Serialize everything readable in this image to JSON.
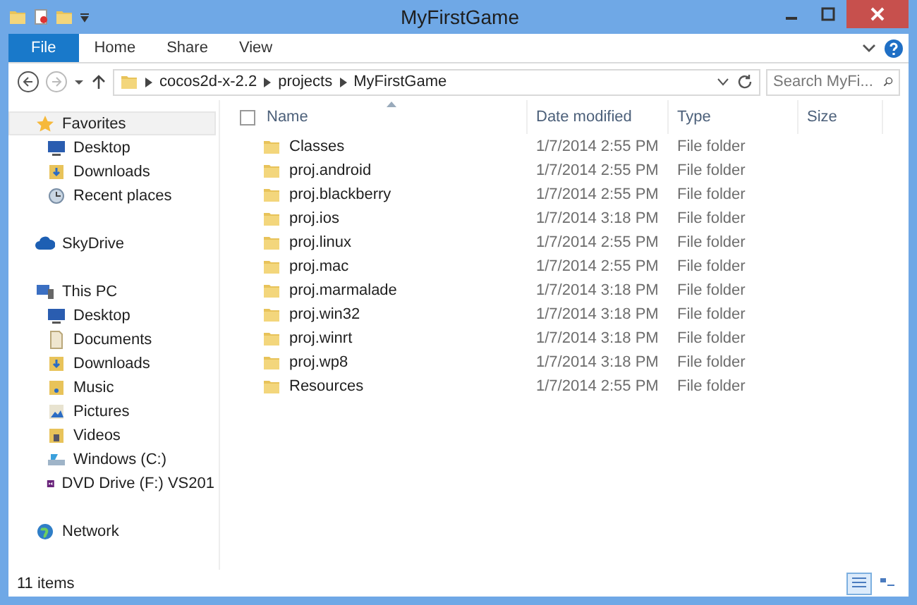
{
  "window": {
    "title": "MyFirstGame"
  },
  "ribbon": {
    "tabs": [
      {
        "label": "File",
        "kind": "file"
      },
      {
        "label": "Home",
        "kind": "tab"
      },
      {
        "label": "Share",
        "kind": "tab"
      },
      {
        "label": "View",
        "kind": "tab"
      }
    ]
  },
  "address": {
    "path": [
      "cocos2d-x-2.2",
      "projects",
      "MyFirstGame"
    ],
    "search_placeholder": "Search MyFi..."
  },
  "sidebar": {
    "groups": [
      {
        "label": "Favorites",
        "kind": "star",
        "selected": true,
        "children": [
          {
            "label": "Desktop",
            "kind": "desktop"
          },
          {
            "label": "Downloads",
            "kind": "download"
          },
          {
            "label": "Recent places",
            "kind": "recent"
          }
        ]
      },
      {
        "label": "SkyDrive",
        "kind": "cloud",
        "selected": false
      },
      {
        "label": "This PC",
        "kind": "pc",
        "selected": false,
        "children": [
          {
            "label": "Desktop",
            "kind": "desktop"
          },
          {
            "label": "Documents",
            "kind": "documents"
          },
          {
            "label": "Downloads",
            "kind": "download"
          },
          {
            "label": "Music",
            "kind": "music"
          },
          {
            "label": "Pictures",
            "kind": "pictures"
          },
          {
            "label": "Videos",
            "kind": "videos"
          },
          {
            "label": "Windows (C:)",
            "kind": "drive"
          },
          {
            "label": "DVD Drive (F:) VS201",
            "kind": "vs"
          }
        ]
      },
      {
        "label": "Network",
        "kind": "network",
        "selected": false
      }
    ]
  },
  "table": {
    "columns": [
      "Name",
      "Date modified",
      "Type",
      "Size"
    ],
    "rows": [
      {
        "name": "Classes",
        "date": "1/7/2014 2:55 PM",
        "type": "File folder"
      },
      {
        "name": "proj.android",
        "date": "1/7/2014 2:55 PM",
        "type": "File folder"
      },
      {
        "name": "proj.blackberry",
        "date": "1/7/2014 2:55 PM",
        "type": "File folder"
      },
      {
        "name": "proj.ios",
        "date": "1/7/2014 3:18 PM",
        "type": "File folder"
      },
      {
        "name": "proj.linux",
        "date": "1/7/2014 2:55 PM",
        "type": "File folder"
      },
      {
        "name": "proj.mac",
        "date": "1/7/2014 2:55 PM",
        "type": "File folder"
      },
      {
        "name": "proj.marmalade",
        "date": "1/7/2014 3:18 PM",
        "type": "File folder"
      },
      {
        "name": "proj.win32",
        "date": "1/7/2014 3:18 PM",
        "type": "File folder"
      },
      {
        "name": "proj.winrt",
        "date": "1/7/2014 3:18 PM",
        "type": "File folder"
      },
      {
        "name": "proj.wp8",
        "date": "1/7/2014 3:18 PM",
        "type": "File folder"
      },
      {
        "name": "Resources",
        "date": "1/7/2014 2:55 PM",
        "type": "File folder"
      }
    ]
  },
  "status_bar": {
    "count": "11 items",
    "view_buttons": [
      {
        "kind": "details",
        "selected": true
      },
      {
        "kind": "tiles",
        "selected": false
      }
    ]
  }
}
